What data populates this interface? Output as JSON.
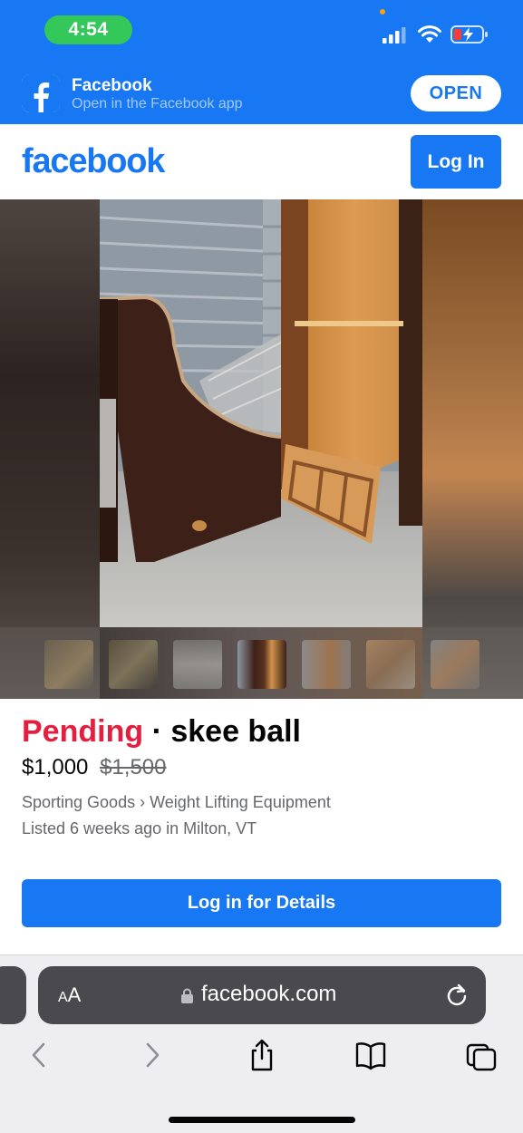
{
  "status_bar": {
    "time": "4:54"
  },
  "app_banner": {
    "app_name": "Facebook",
    "subtitle": "Open in the Facebook app",
    "open_label": "OPEN"
  },
  "header": {
    "logo_text": "facebook",
    "login_label": "Log In"
  },
  "photo_gallery": {
    "thumbnail_count": 7,
    "active_index": 3
  },
  "listing": {
    "status": "Pending",
    "separator": "·",
    "title": "skee ball",
    "price": "$1,000",
    "original_price": "$1,500",
    "category": "Sporting Goods › Weight Lifting Equipment",
    "listed": "Listed 6 weeks ago in Milton, VT",
    "details_button": "Log in for Details"
  },
  "browser": {
    "text_size_label_big": "A",
    "text_size_label_small": "A",
    "url": "facebook.com"
  },
  "colors": {
    "brand_blue": "#1877f2",
    "pending_red": "#e41e3f",
    "secondary_text": "#65676b"
  }
}
